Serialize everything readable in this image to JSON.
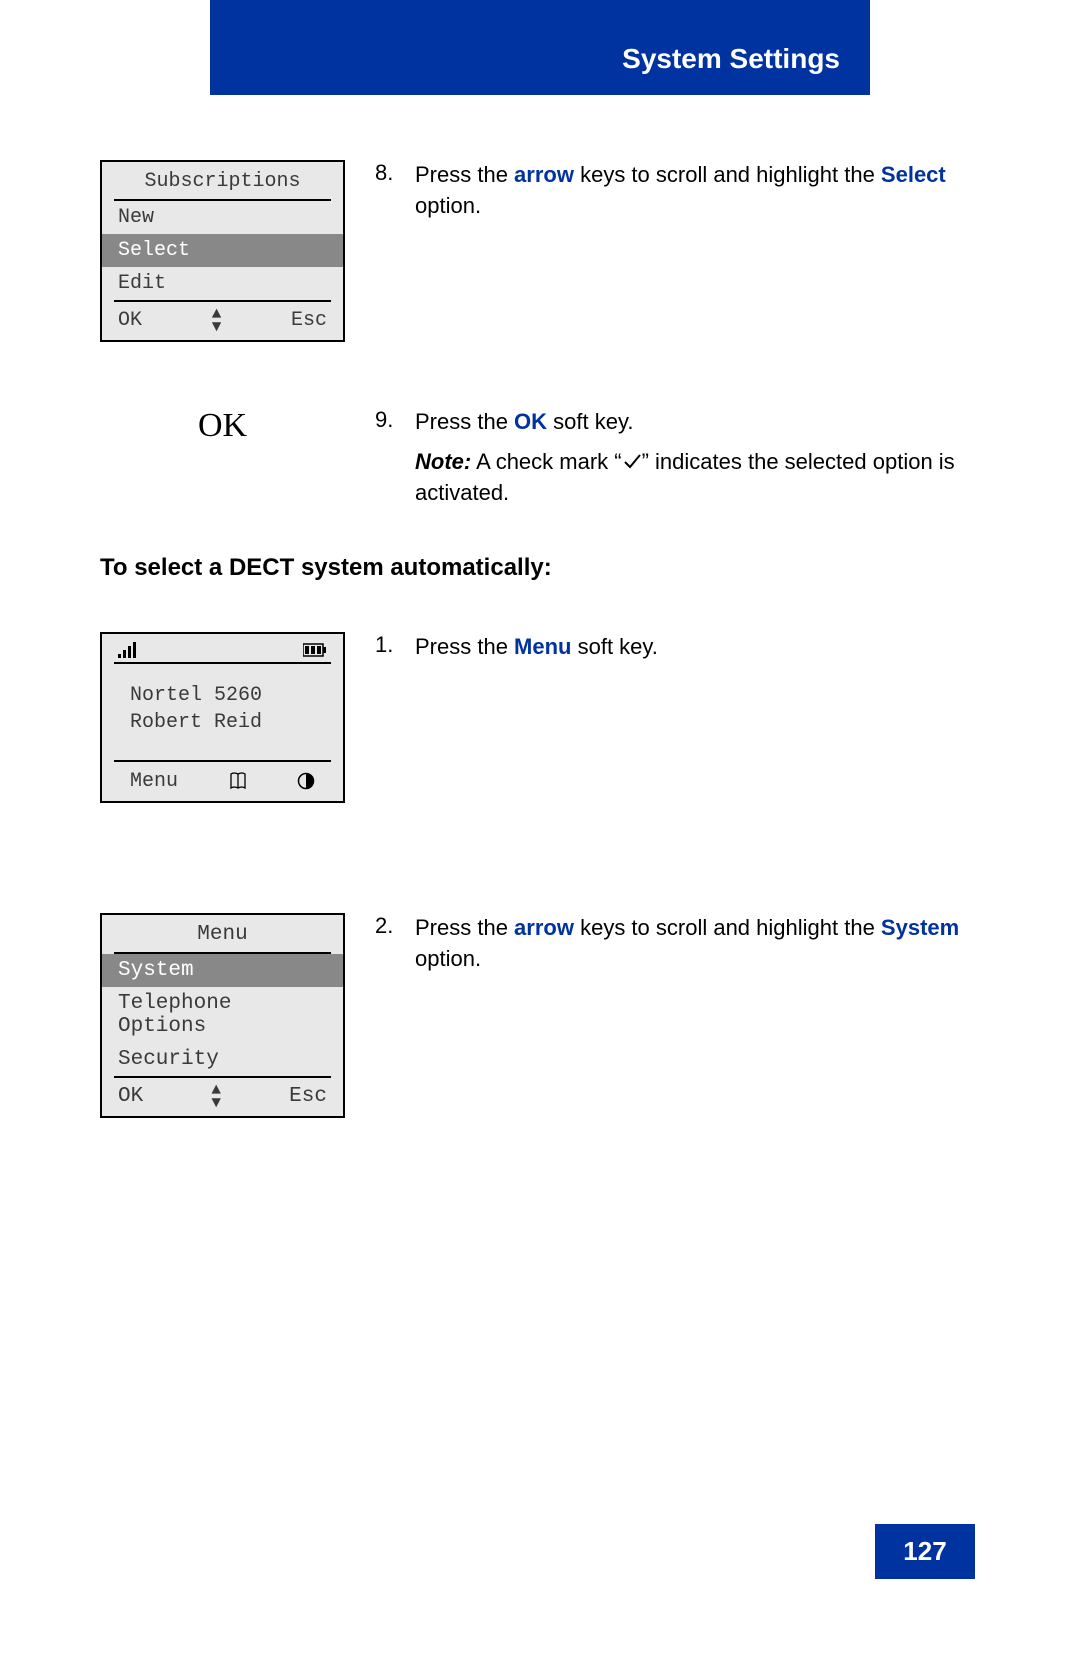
{
  "header": {
    "title": "System Settings"
  },
  "page_number": "127",
  "screen1": {
    "title": "Subscriptions",
    "items": [
      "New",
      "Select",
      "Edit"
    ],
    "selected_index": 1,
    "soft_left": "OK",
    "soft_right": "Esc"
  },
  "step8": {
    "num": "8.",
    "pre": "Press the ",
    "kw1": "arrow",
    "mid": " keys to scroll and highlight the ",
    "kw2": "Select",
    "post": " option."
  },
  "ok_label": "OK",
  "step9": {
    "num": "9.",
    "pre": "Press the ",
    "kw1": "OK",
    "post": " soft key."
  },
  "note9": {
    "label": "Note:",
    "pre": " A check mark “",
    "post": "” indicates the selected option is activated."
  },
  "section_heading": "To select a DECT system automatically:",
  "idle": {
    "line1": "Nortel 5260",
    "line2": "Robert Reid",
    "soft_left": "Menu"
  },
  "step1": {
    "num": "1.",
    "pre": "Press the ",
    "kw1": "Menu",
    "post": " soft key."
  },
  "screen_menu": {
    "title": "Menu",
    "items": [
      "System",
      "Telephone Options",
      "Security"
    ],
    "selected_index": 0,
    "soft_left": "OK",
    "soft_right": "Esc"
  },
  "step2": {
    "num": "2.",
    "pre": "Press the ",
    "kw1": "arrow",
    "mid": " keys to scroll and highlight the ",
    "kw2": "System",
    "post": " option."
  }
}
